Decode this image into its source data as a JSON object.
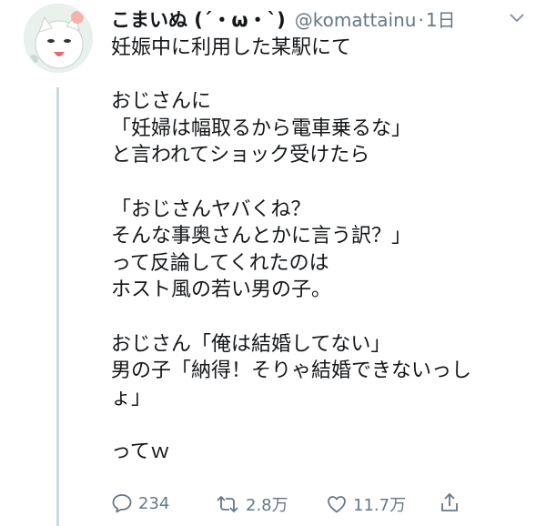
{
  "user": {
    "display_name": "こまいぬ (´・ω・`)",
    "handle": "@komattainu",
    "separator": "·",
    "time": "1日"
  },
  "tweet": {
    "lines": [
      "妊娠中に利用した某駅にて",
      "",
      "おじさんに",
      "「妊婦は幅取るから電車乗るな」",
      "と言われてショック受けたら",
      "",
      "「おじさんヤバくね？",
      "そんな事奥さんとかに言う訳？」",
      "って反論してくれたのは",
      "ホスト風の若い男の子。",
      "",
      "おじさん「俺は結婚してない」",
      "男の子「納得！そりゃ結婚できないっし",
      "ょ」",
      "",
      "ってｗ"
    ]
  },
  "actions": {
    "reply_count": "234",
    "retweet_count": "2.8万",
    "like_count": "11.7万"
  },
  "icons": {
    "reply": "reply-icon",
    "retweet": "retweet-icon",
    "like": "heart-icon",
    "share": "share-icon",
    "menu": "chevron-down-icon"
  },
  "colors": {
    "text": "#14171a",
    "secondary": "#657786",
    "thread_line": "#ccd6dd"
  }
}
